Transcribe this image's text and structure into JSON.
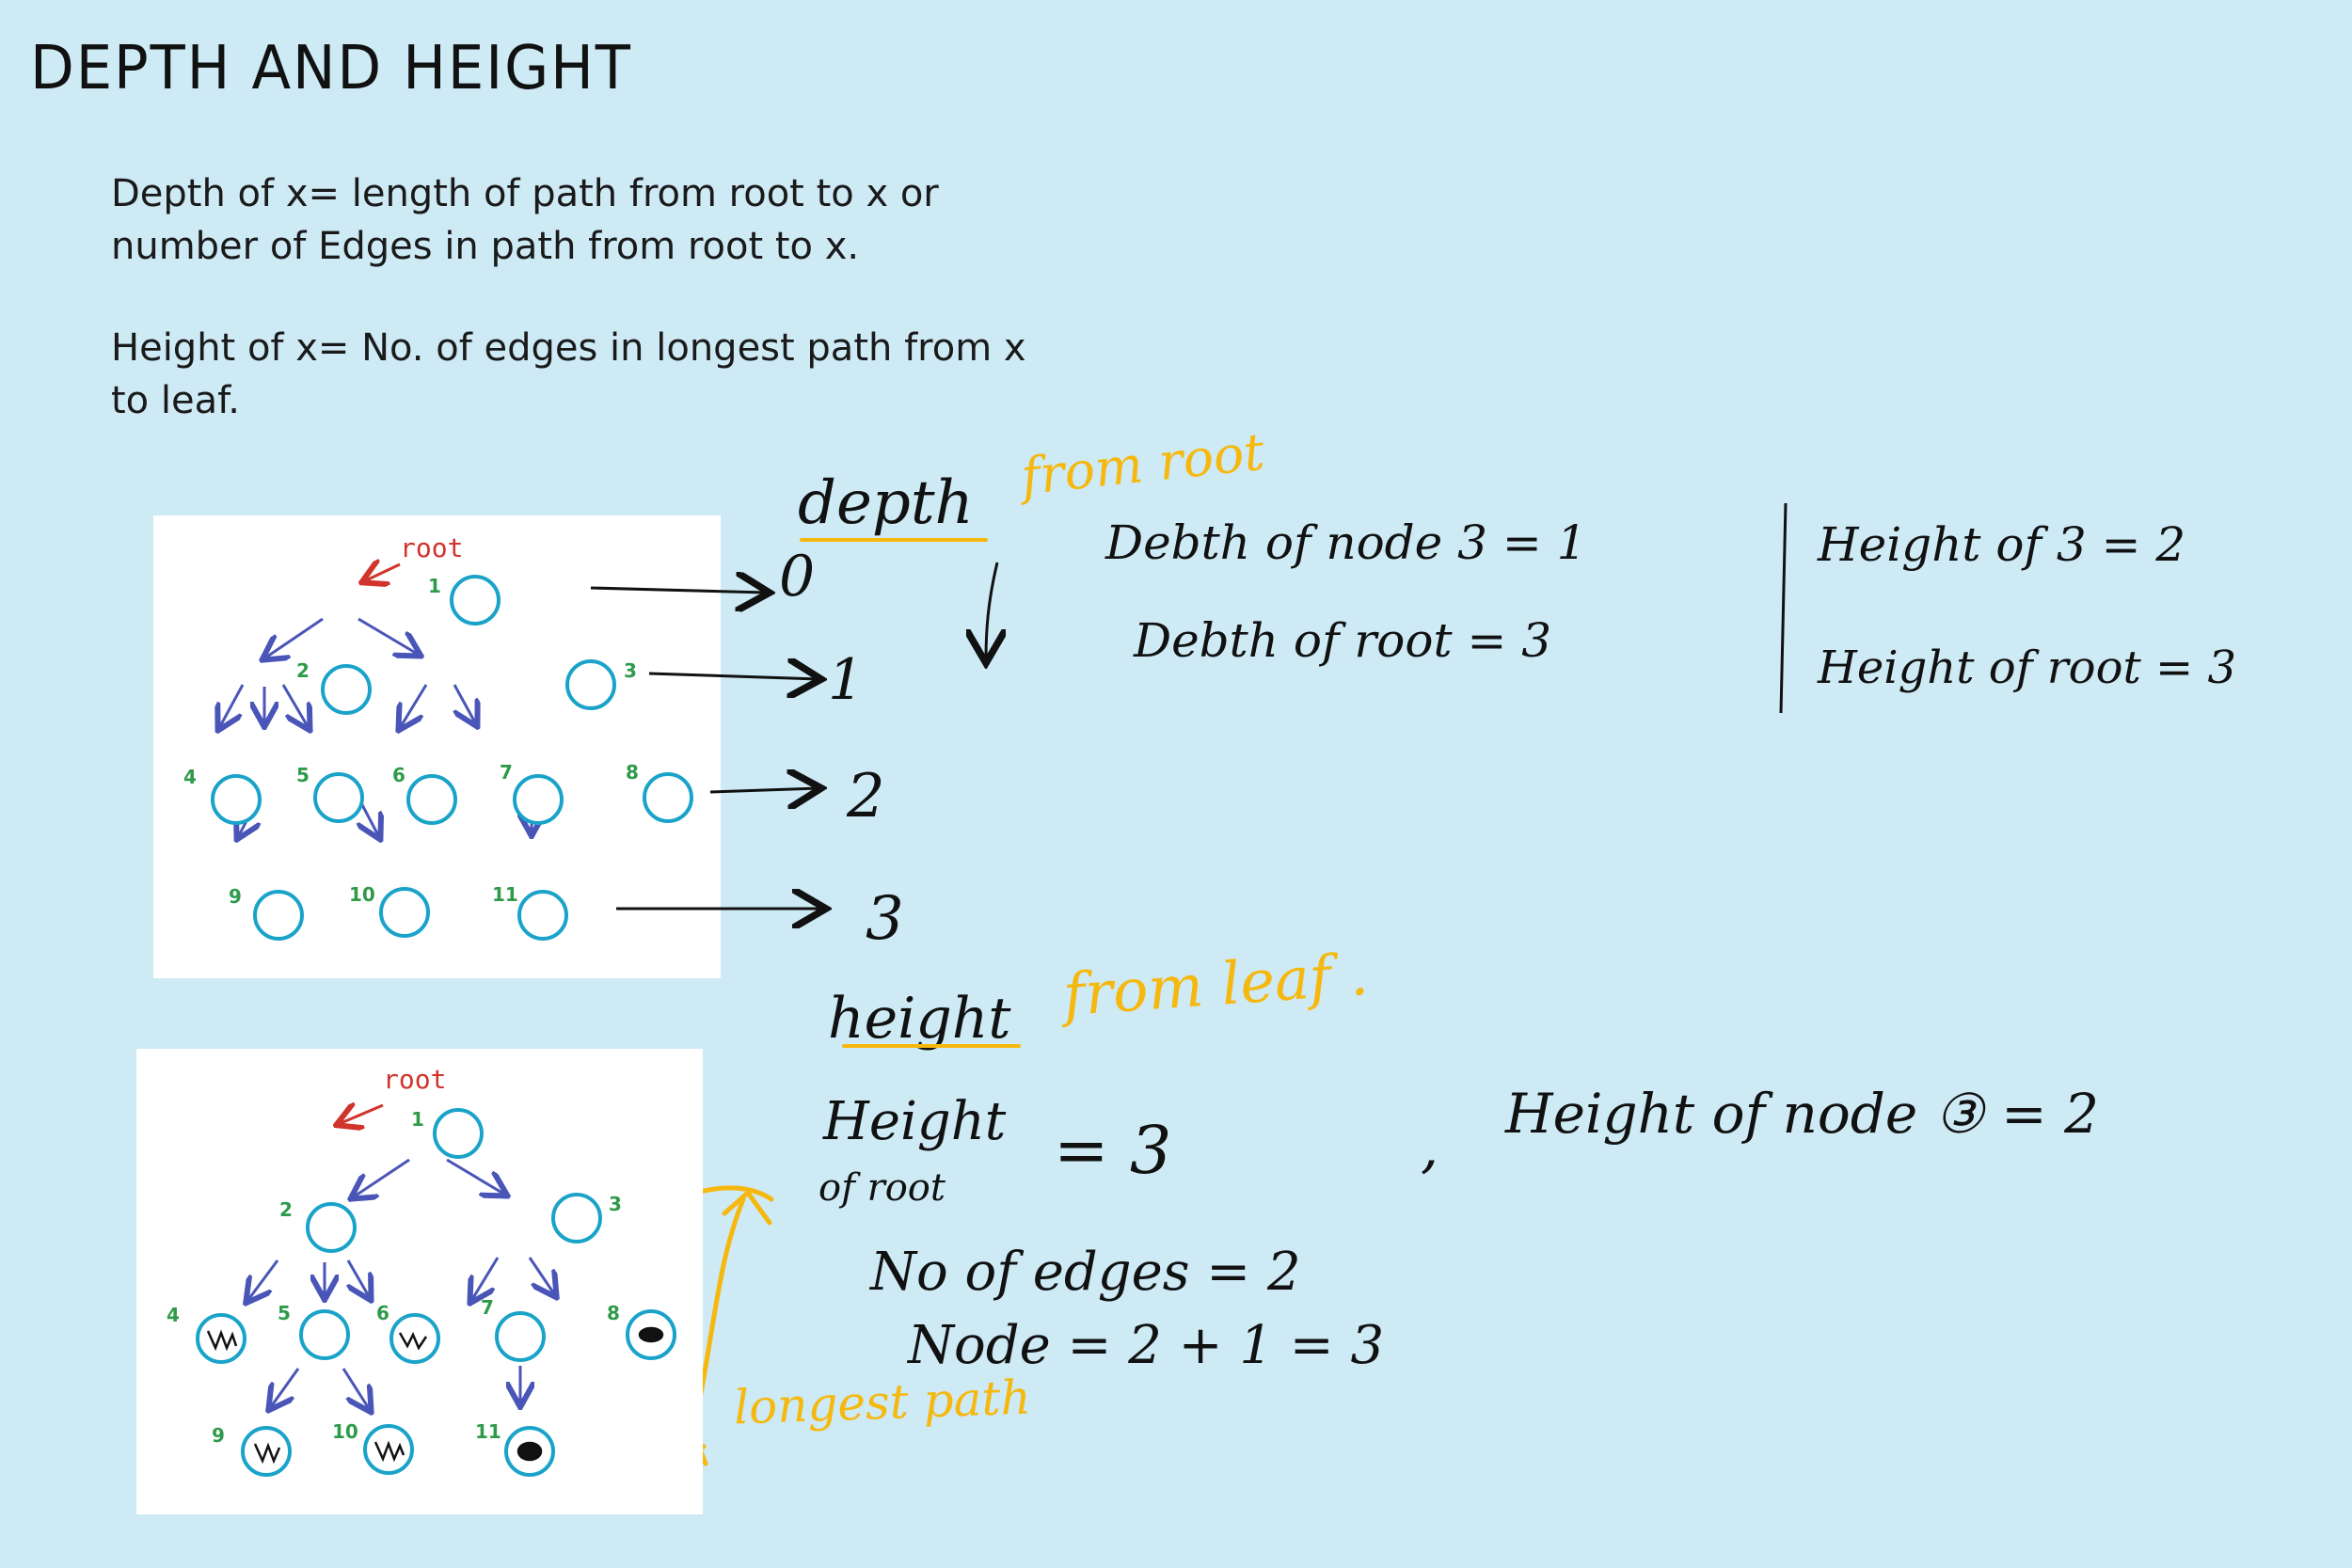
{
  "title": "DEPTH AND HEIGHT",
  "definitions": {
    "depth_line1": "Depth of x= length of path from root to x or",
    "depth_line2": "number of Edges in path from root to x.",
    "height_line1": "Height of x= No. of edges in longest path from x",
    "height_line2": "to leaf."
  },
  "tree": {
    "root_label": "root",
    "nodes": [
      "1",
      "2",
      "3",
      "4",
      "5",
      "6",
      "7",
      "8",
      "9",
      "10",
      "11"
    ]
  },
  "depth_section": {
    "heading": "depth",
    "note": "from root",
    "levels": [
      "0",
      "1",
      "2",
      "3"
    ],
    "eq1": "Debth of node 3 = 1",
    "eq2": "Debth of root = 3",
    "eq3": "Height of 3 = 2",
    "eq4": "Height of root = 3"
  },
  "height_section": {
    "heading": "height",
    "note": "from leaf .",
    "height_label_1": "Height",
    "height_label_2": "of root",
    "height_value": "= 3",
    "edges": "No of edges = 2",
    "node_calc": "Node = 2 + 1 = 3",
    "node3": "Height of node ③ = 2",
    "comma": ",",
    "longest": "longest path"
  },
  "colors": {
    "background": "#cdeaf5",
    "node": "#1aa3c9",
    "edge_arrow": "#4a55b8",
    "root_arrow": "#d0342c",
    "label_green": "#2e9a4a",
    "highlight": "#f6b80f"
  }
}
